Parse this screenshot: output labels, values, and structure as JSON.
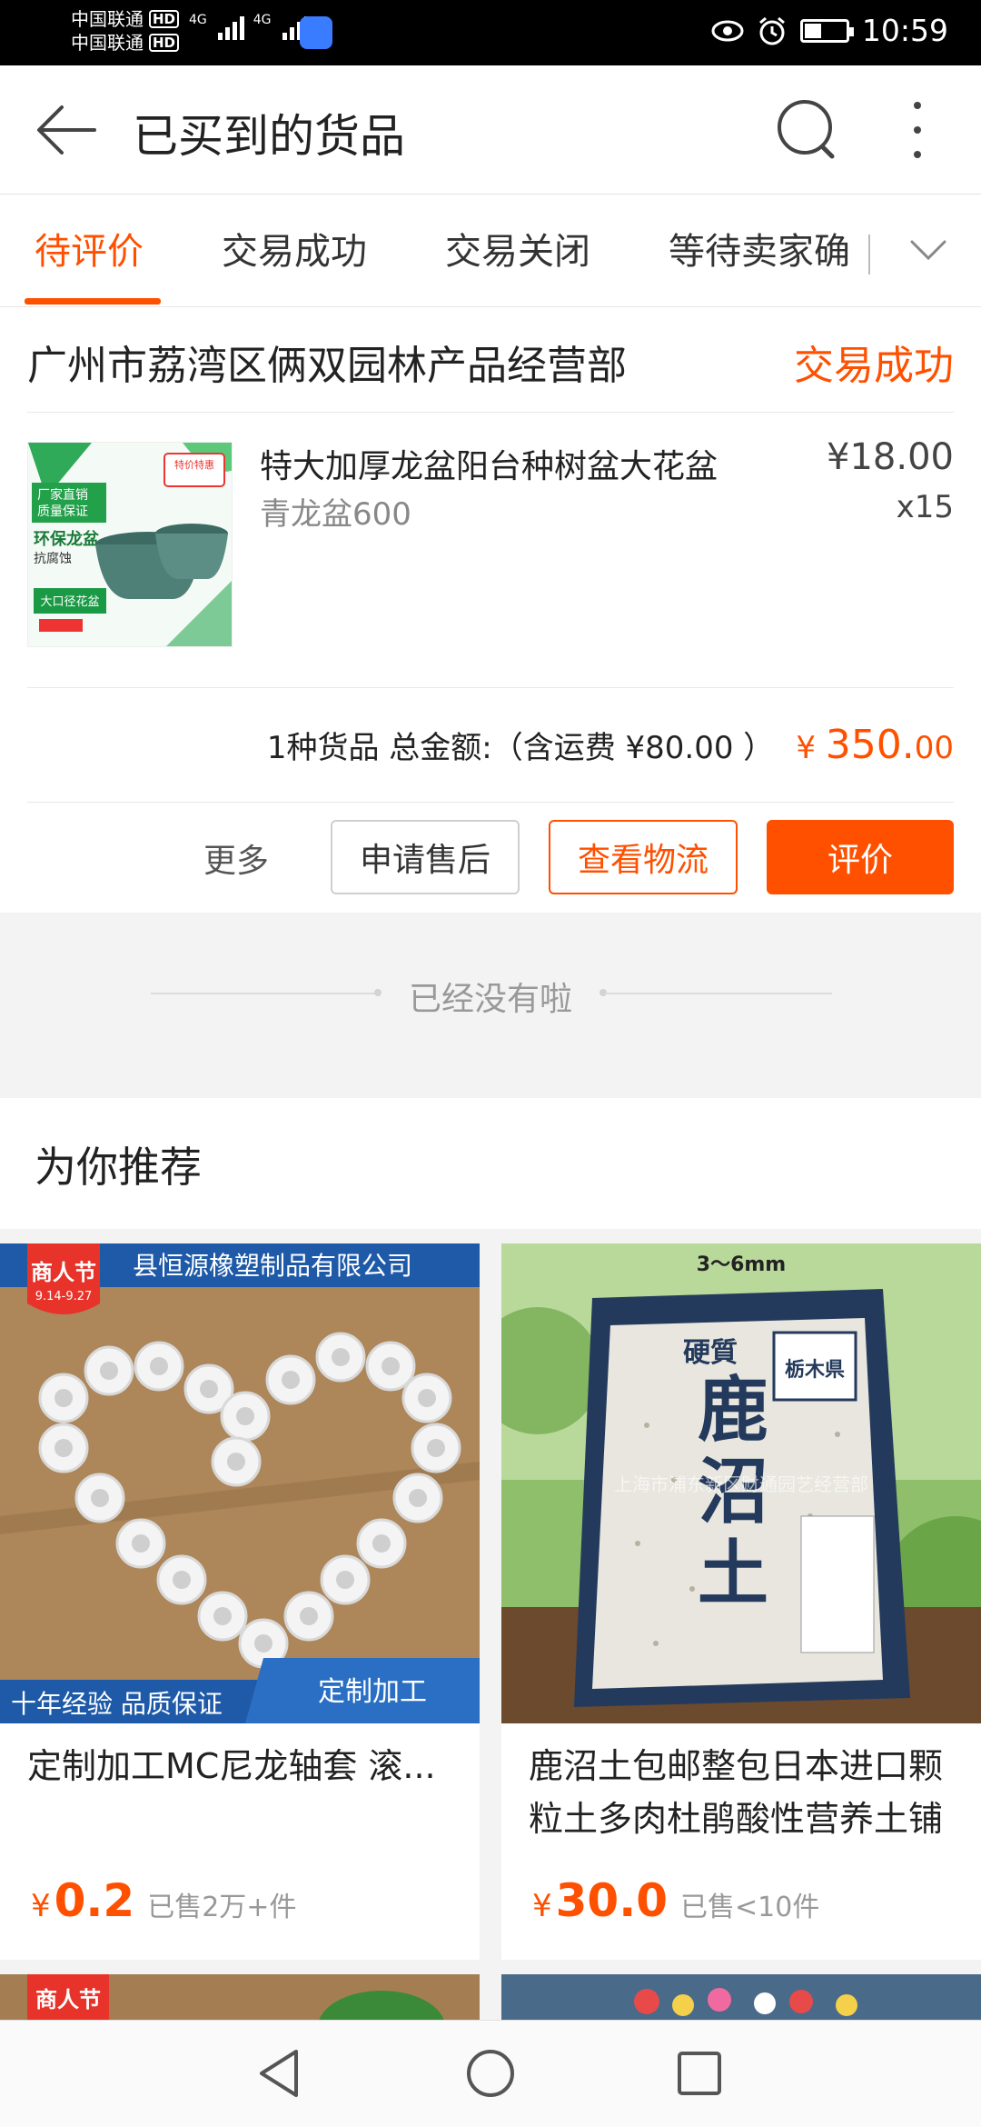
{
  "status_bar": {
    "carrier_1": "中国联通",
    "carrier_2": "中国联通",
    "hd_label": "HD",
    "network_label": "4G",
    "time": "10:59"
  },
  "header": {
    "title": "已买到的货品"
  },
  "tabs": [
    {
      "label": "待评价",
      "active": true
    },
    {
      "label": "交易成功",
      "active": false
    },
    {
      "label": "交易关闭",
      "active": false
    },
    {
      "label": "等待卖家确",
      "active": false
    }
  ],
  "order": {
    "shop_name": "广州市荔湾区俩双园林产品经营部",
    "status": "交易成功",
    "product": {
      "title": "特大加厚龙盆阳台种树盆大花盆",
      "spec": "青龙盆600",
      "price": "¥18.00",
      "quantity": "x15",
      "image_labels": {
        "badge": "厂家直销\n质量保证",
        "name": "环保龙盆",
        "sub": "抗腐蚀",
        "bottom": "大口径花盆",
        "tag": "特价特惠"
      }
    },
    "summary": {
      "text": "1种货品 总金额:（含运费 ¥80.00 ）",
      "total_symbol": "¥",
      "total_int": "350.",
      "total_dec": "00"
    },
    "actions": {
      "more": "更多",
      "after_sale": "申请售后",
      "logistics": "查看物流",
      "review": "评价"
    }
  },
  "end_text": "已经没有啦",
  "recommend": {
    "title": "为你推荐",
    "items": [
      {
        "title": "定制加工MC尼龙轴套 滚...",
        "price_symbol": "¥",
        "price": "0.2",
        "sold": "已售2万+件",
        "image_text": {
          "company": "县恒源橡塑制品有限公司",
          "badge": "商人节",
          "badge_date": "9.14-9.27",
          "footer_left": "十年经验  品质保证",
          "footer_right": "定制加工"
        }
      },
      {
        "title": "鹿沼土包邮整包日本进口颗粒土多肉杜鹃酸性营养土铺",
        "price_symbol": "¥",
        "price": "30.0",
        "sold": "已售<10件",
        "image_text": {
          "size": "3～6mm",
          "brand_top": "硬質",
          "brand_main": "鹿沼土",
          "origin": "栃木県",
          "watermark": "上海市浦东新区财通园艺经营部"
        }
      }
    ],
    "next_badge": "商人节"
  },
  "colors": {
    "accent": "#ff5000",
    "muted": "#999999",
    "background": "#f3f3f3"
  }
}
